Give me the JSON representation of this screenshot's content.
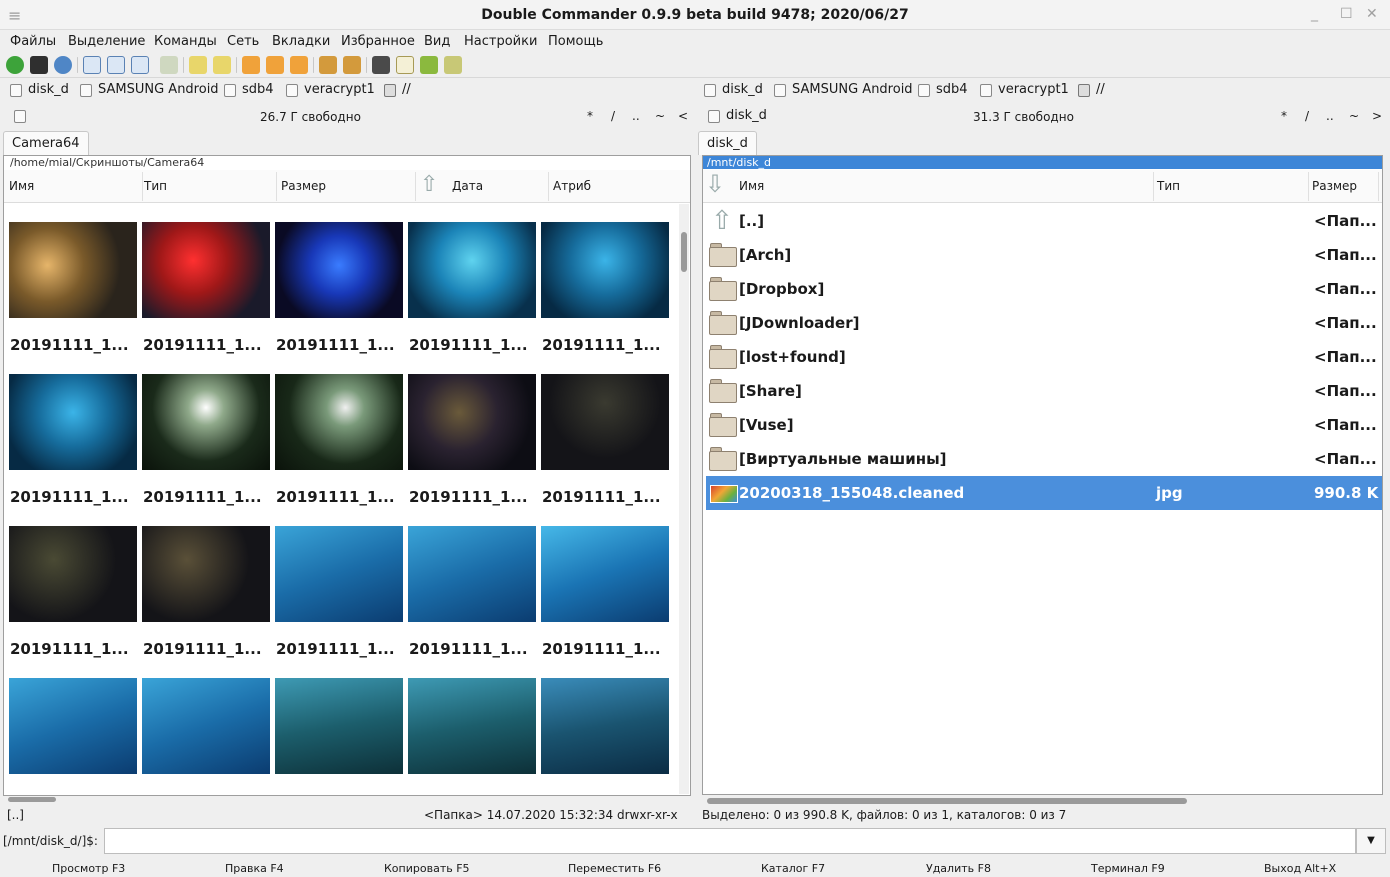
{
  "window": {
    "title": "Double Commander 0.9.9 beta build 9478; 2020/06/27"
  },
  "menu": [
    "Файлы",
    "Выделение",
    "Команды",
    "Сеть",
    "Вкладки",
    "Избранное",
    "Вид",
    "Настройки",
    "Помощь"
  ],
  "drives": {
    "items": [
      "disk_d",
      "SAMSUNG Android",
      "sdb4",
      "veracrypt1",
      "//"
    ]
  },
  "left": {
    "drive_label": "",
    "free": "26.7 Г свободно",
    "nav": [
      "*",
      "/",
      "..",
      "~",
      "<"
    ],
    "tab": "Camera64",
    "path": "/home/mial/Скриншоты/Camera64",
    "columns": [
      "Имя",
      "Тип",
      "Размер",
      "Дата",
      "Атриб"
    ],
    "thumb_label": "20191111_1...",
    "status": "[..]",
    "status_right": "<Папка>  14.07.2020 15:32:34  drwxr-xr-x"
  },
  "right": {
    "drive_label": "disk_d",
    "free": "31.3 Г свободно",
    "nav": [
      "*",
      "/",
      "..",
      "~",
      ">"
    ],
    "tab": "disk_d",
    "path": "/mnt/disk_d",
    "columns": [
      "Имя",
      "Тип",
      "Размер"
    ],
    "rows": [
      {
        "name": "[..]",
        "type": "",
        "size": "<Пап..."
      },
      {
        "name": "[Arch]",
        "type": "",
        "size": "<Пап..."
      },
      {
        "name": "[Dropbox]",
        "type": "",
        "size": "<Пап..."
      },
      {
        "name": "[JDownloader]",
        "type": "",
        "size": "<Пап..."
      },
      {
        "name": "[lost+found]",
        "type": "",
        "size": "<Пап..."
      },
      {
        "name": "[Share]",
        "type": "",
        "size": "<Пап..."
      },
      {
        "name": "[Vuse]",
        "type": "",
        "size": "<Пап..."
      },
      {
        "name": "[Виртуальные машины]",
        "type": "",
        "size": "<Пап..."
      },
      {
        "name": "20200318_155048.cleaned",
        "type": "jpg",
        "size": "990.8 K"
      }
    ],
    "status": "Выделено: 0 из 990.8 K, файлов: 0 из 1, каталогов: 0 из 7"
  },
  "cmdline": {
    "prompt": "[/mnt/disk_d/]$:",
    "value": ""
  },
  "fkeys": [
    "Просмотр F3",
    "Правка F4",
    "Копировать F5",
    "Переместить F6",
    "Каталог F7",
    "Удалить F8",
    "Терминал F9",
    "Выход Alt+X"
  ],
  "colors": {
    "selection": "#4b8fdc",
    "path_active": "#3d86d8"
  }
}
